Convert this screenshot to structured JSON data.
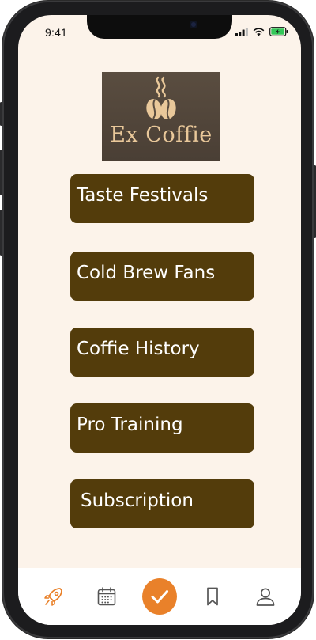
{
  "status_bar": {
    "time": "9:41"
  },
  "logo": {
    "brand_text": "Ex Coffie"
  },
  "menu": {
    "items": [
      {
        "label": "Taste Festivals"
      },
      {
        "label": "Cold Brew Fans"
      },
      {
        "label": "Coffie History"
      },
      {
        "label": "Pro Training"
      },
      {
        "label": "Subscription"
      }
    ]
  },
  "tab_bar": {
    "tabs": [
      {
        "icon": "rocket-icon"
      },
      {
        "icon": "calendar-icon"
      },
      {
        "icon": "check-icon",
        "active": true
      },
      {
        "icon": "bookmark-icon"
      },
      {
        "icon": "user-icon"
      }
    ]
  },
  "colors": {
    "background": "#fcf3ea",
    "button": "#533c0b",
    "accent": "#e9812a",
    "logo_text": "#e9c89a"
  }
}
